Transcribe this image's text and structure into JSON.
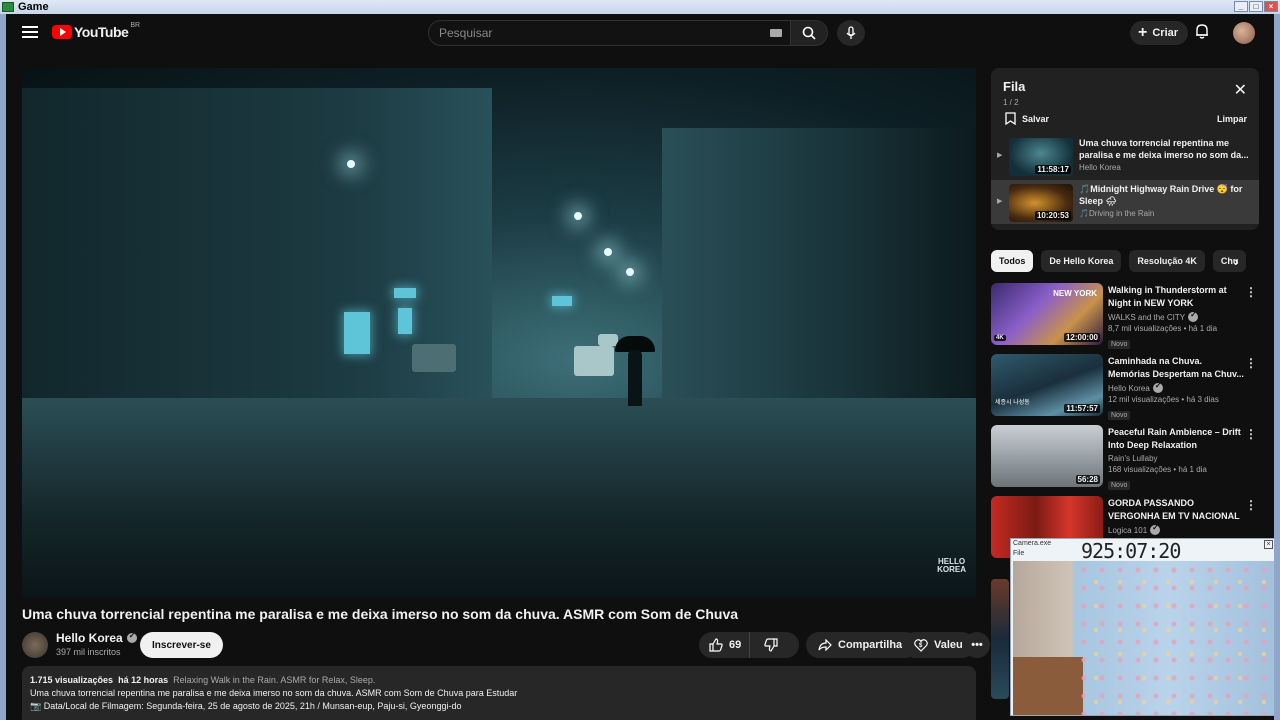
{
  "window": {
    "title": "Game"
  },
  "header": {
    "logo_text": "YouTube",
    "logo_region": "BR",
    "search_placeholder": "Pesquisar",
    "create_label": "Criar"
  },
  "video": {
    "title": "Uma chuva torrencial repentina me paralisa e me deixa imerso no som da chuva. ASMR com Som de Chuva",
    "watermark_line1": "HELLO",
    "watermark_line2": "KOREA",
    "channel": "Hello Korea",
    "subscribers": "397 mil inscritos",
    "subscribe_label": "Inscrever-se",
    "likes": "69",
    "share_label": "Compartilhar",
    "thanks_label": "Valeu",
    "description": {
      "views": "1.715 visualizações",
      "age": "há 12 horas",
      "tags": "Relaxing Walk in the Rain. ASMR for Relax, Sleep.",
      "line1": "Uma chuva torrencial repentina me paralisa e me deixa imerso no som da chuva. ASMR com Som de Chuva para Estudar",
      "line2": "📷 Data/Local de Filmagem: Segunda-feira, 25 de agosto de 2025, 21h / Munsan-eup, Paju-si, Gyeonggi-do"
    }
  },
  "queue": {
    "title": "Fila",
    "position": "1 / 2",
    "save_label": "Salvar",
    "clear_label": "Limpar",
    "items": [
      {
        "title": "Uma chuva torrencial repentina me paralisa e me deixa imerso no som da...",
        "channel": "Hello Korea",
        "duration": "11:58:17"
      },
      {
        "title": "🎵Midnight Highway Rain Drive 😴 for Sleep 🌧",
        "channel": "🎵Driving in the Rain",
        "duration": "10:20:53"
      }
    ]
  },
  "chips": [
    "Todos",
    "De Hello Korea",
    "Resolução 4K",
    "Chu"
  ],
  "recommendations": [
    {
      "title": "Walking in Thunderstorm at Night in NEW YORK",
      "channel": "WALKS and the CITY",
      "meta": "8,7 mil visualizações • há 1 dia",
      "badge": "Novo",
      "duration": "12:00:00",
      "thumb_text": "NEW YORK"
    },
    {
      "title": "Caminhada na Chuva. Memórias Despertam na Chuv...",
      "channel": "Hello Korea",
      "meta": "12 mil visualizações • há 3 dias",
      "badge": "Novo",
      "duration": "11:57:57",
      "thumb_text": "세종시 나성동"
    },
    {
      "title": "Peaceful Rain Ambience – Drift Into Deep Relaxation",
      "channel": "Rain's Lullaby",
      "meta": "168 visualizações • há 1 dia",
      "badge": "Novo",
      "duration": "56:28",
      "thumb_text": ""
    },
    {
      "title": "GORDA PASSANDO VERGONHA EM TV NACIONAL",
      "channel": "Logica 101",
      "meta": "",
      "badge": "",
      "duration": "",
      "thumb_text": ""
    }
  ],
  "camera_overlay": {
    "title": "Camera.exe",
    "file_label": "File",
    "timestamp": "925:07:20"
  }
}
